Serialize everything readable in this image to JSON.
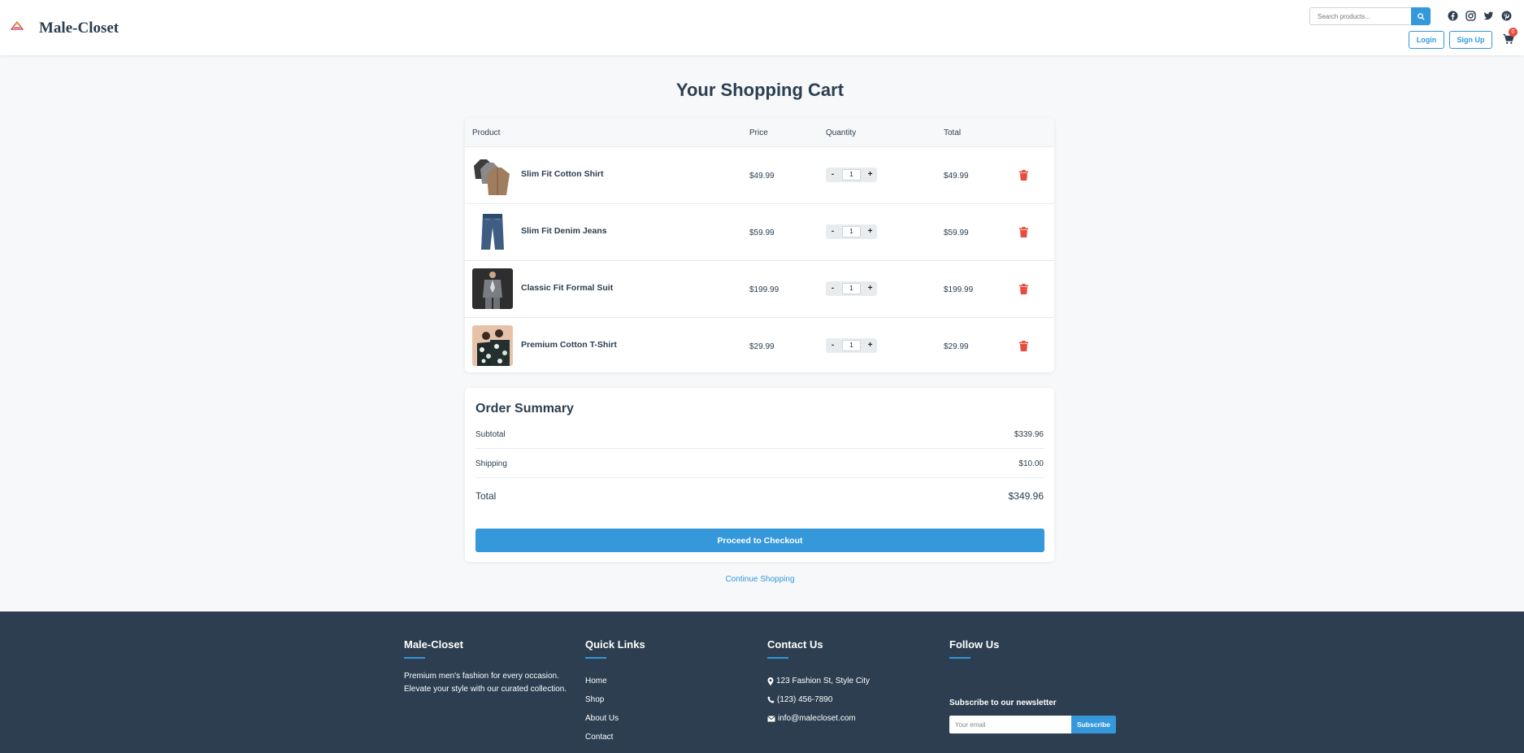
{
  "header": {
    "brand": "Male-Closet",
    "search_placeholder": "Search products...",
    "login_label": "Login",
    "signup_label": "Sign Up",
    "cart_count": "0",
    "social_icons": [
      "facebook-icon",
      "instagram-icon",
      "twitter-icon",
      "pinterest-icon"
    ]
  },
  "cart": {
    "title": "Your Shopping Cart",
    "columns": [
      "Product",
      "Price",
      "Quantity",
      "Total"
    ],
    "items": [
      {
        "name": "Slim Fit Cotton Shirt",
        "price": "$49.99",
        "quantity": "1",
        "total": "$49.99"
      },
      {
        "name": "Slim Fit Denim Jeans",
        "price": "$59.99",
        "quantity": "1",
        "total": "$59.99"
      },
      {
        "name": "Classic Fit Formal Suit",
        "price": "$199.99",
        "quantity": "1",
        "total": "$199.99"
      },
      {
        "name": "Premium Cotton T-Shirt",
        "price": "$29.99",
        "quantity": "1",
        "total": "$29.99"
      }
    ],
    "minus_label": "-",
    "plus_label": "+"
  },
  "summary": {
    "title": "Order Summary",
    "subtotal_label": "Subtotal",
    "subtotal_value": "$339.96",
    "shipping_label": "Shipping",
    "shipping_value": "$10.00",
    "total_label": "Total",
    "total_value": "$349.96",
    "checkout_label": "Proceed to Checkout",
    "continue_label": "Continue Shopping"
  },
  "footer": {
    "about_title": "Male-Closet",
    "about_text_1": "Premium men's fashion for every occasion.",
    "about_text_2": "Elevate your style with our curated collection.",
    "links_title": "Quick Links",
    "links": [
      "Home",
      "Shop",
      "About Us",
      "Contact"
    ],
    "contact_title": "Contact Us",
    "address": "123 Fashion St, Style City",
    "phone": "(123) 456-7890",
    "email": "info@malecloset.com",
    "follow_title": "Follow Us",
    "newsletter_title": "Subscribe to our newsletter",
    "newsletter_placeholder": "Your email",
    "subscribe_label": "Subscribe"
  },
  "colors": {
    "accent": "#3498db",
    "dark": "#2c3e50",
    "danger": "#e74c3c",
    "background": "#f7f8fa"
  }
}
